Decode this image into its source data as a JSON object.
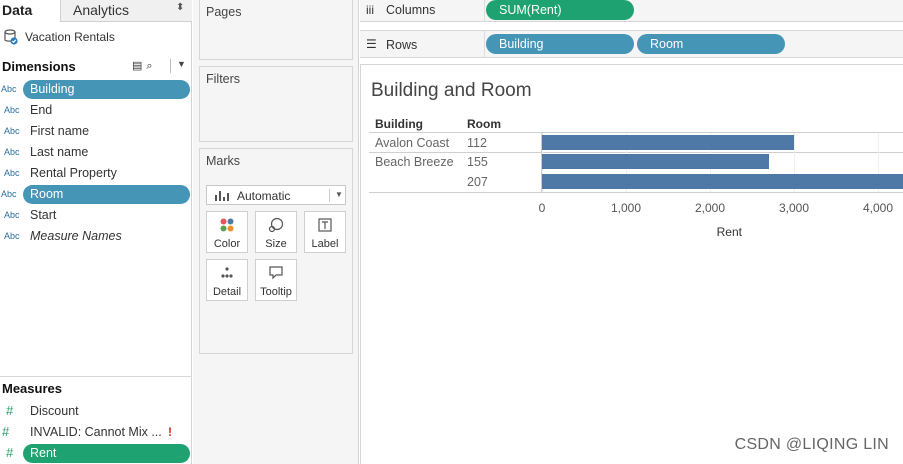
{
  "tabs": {
    "data": "Data",
    "analytics": "Analytics"
  },
  "datasource": "Vacation Rentals",
  "dimensions": {
    "title": "Dimensions",
    "fields": [
      {
        "icon": "Abc",
        "name": "Building",
        "state": "in-use"
      },
      {
        "icon": "Abc",
        "name": "End"
      },
      {
        "icon": "Abc",
        "name": "First name"
      },
      {
        "icon": "Abc",
        "name": "Last name"
      },
      {
        "icon": "Abc",
        "name": "Rental Property"
      },
      {
        "icon": "Abc",
        "name": "Room",
        "state": "in-use"
      },
      {
        "icon": "Abc",
        "name": "Start"
      },
      {
        "icon": "Abc",
        "name": "Measure Names"
      }
    ]
  },
  "measures": {
    "title": "Measures",
    "fields": [
      {
        "icon": "#",
        "name": "Discount"
      },
      {
        "icon": "#",
        "name": "INVALID: Cannot Mix ...",
        "warning": "!"
      },
      {
        "icon": "#",
        "name": "Rent",
        "state": "in-use"
      }
    ]
  },
  "cards": {
    "pages": "Pages",
    "filters": "Filters",
    "marks": "Marks"
  },
  "marks": {
    "type": "Automatic",
    "buttons": [
      "Color",
      "Size",
      "Label",
      "Detail",
      "Tooltip"
    ]
  },
  "shelves": {
    "columns_label": "Columns",
    "rows_label": "Rows",
    "columns_pills": [
      "SUM(Rent)"
    ],
    "rows_pills": [
      "Building",
      "Room"
    ]
  },
  "view": {
    "title": "Building and Room",
    "headers": {
      "building": "Building",
      "room": "Room"
    },
    "rows": [
      {
        "building": "Avalon Coast",
        "room": "112"
      },
      {
        "building": "Beach Breeze",
        "room": "155"
      },
      {
        "building": "",
        "room": "207"
      }
    ]
  },
  "chart_data": {
    "type": "bar",
    "orientation": "horizontal",
    "title": "Building and Room",
    "categories": [
      "Avalon Coast / 112",
      "Beach Breeze / 155",
      "Beach Breeze / 207"
    ],
    "values": [
      3000,
      2700,
      4300
    ],
    "xlabel": "Rent",
    "xticks": [
      "0",
      "1,000",
      "2,000",
      "3,000",
      "4,000"
    ],
    "xlim": [
      0,
      4300
    ],
    "grid": true,
    "bar_color": "#4e79a7"
  },
  "colors": {
    "dimension_pill": "#4596b6",
    "measure_pill": "#1fa271",
    "bar": "#4e79a7"
  },
  "watermark": "CSDN @LIQING LIN"
}
